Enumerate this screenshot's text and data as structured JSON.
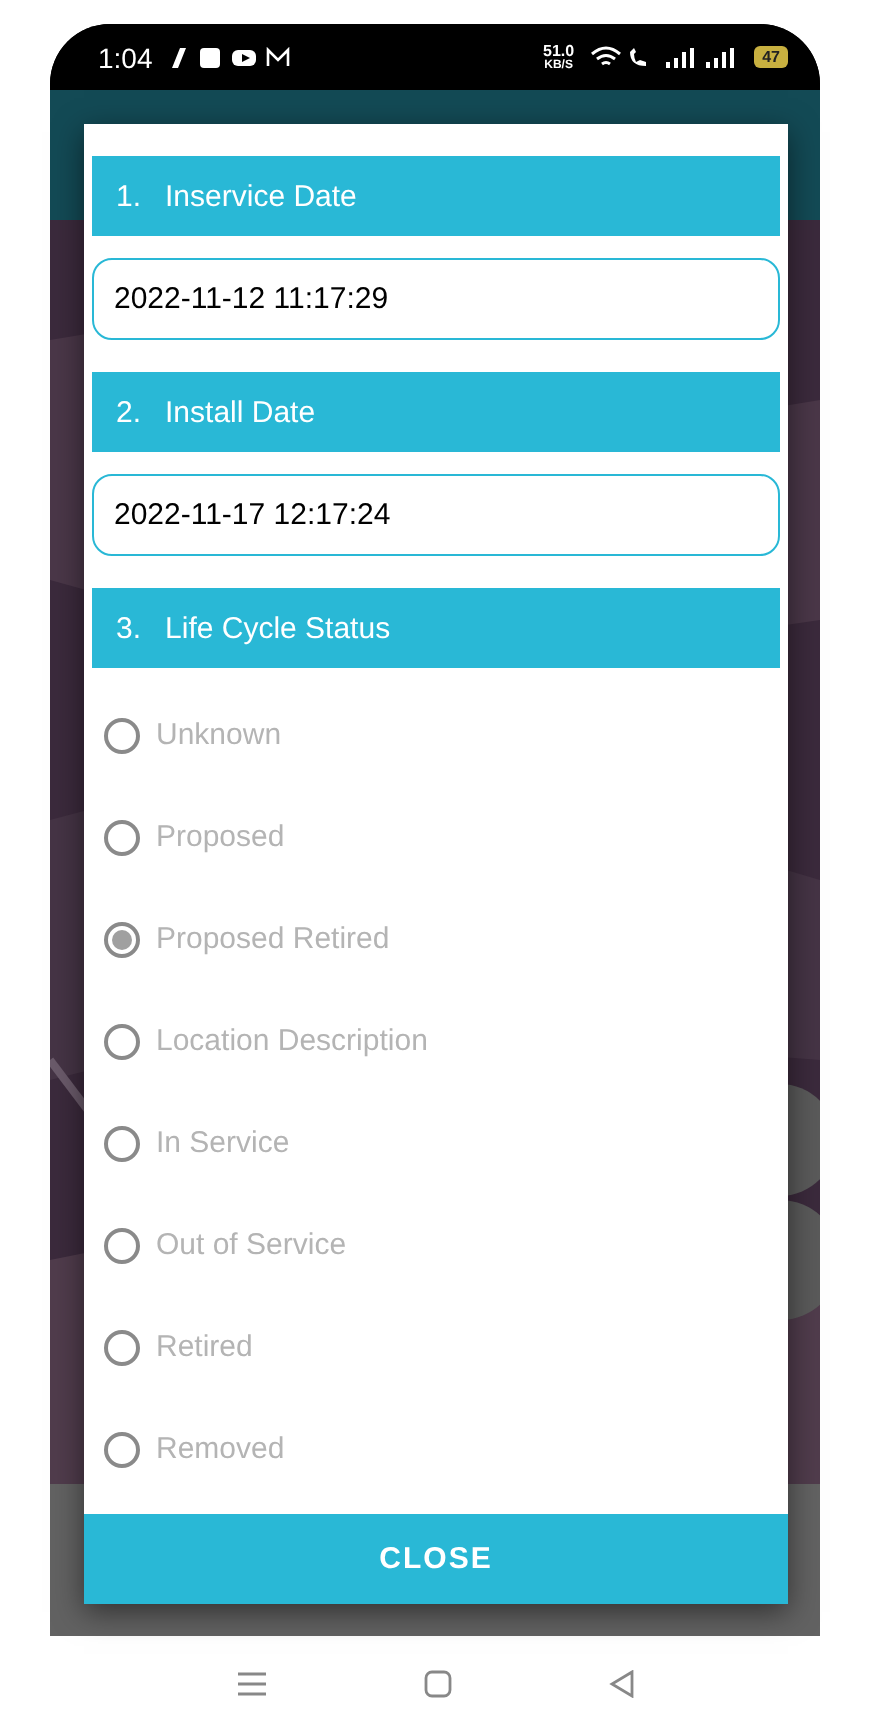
{
  "status_bar": {
    "time": "1:04",
    "speed": "51.0",
    "speed_unit": "KB/S",
    "battery": "47"
  },
  "dialog": {
    "sections": [
      {
        "number": "1.",
        "title": "Inservice Date",
        "kind": "field",
        "value": "2022-11-12 11:17:29"
      },
      {
        "number": "2.",
        "title": "Install Date",
        "kind": "field",
        "value": "2022-11-17 12:17:24"
      },
      {
        "number": "3.",
        "title": "Life Cycle Status",
        "kind": "radio",
        "options": [
          {
            "label": "Unknown",
            "selected": false
          },
          {
            "label": "Proposed",
            "selected": false
          },
          {
            "label": "Proposed Retired",
            "selected": true
          },
          {
            "label": "Location Description",
            "selected": false
          },
          {
            "label": "In Service",
            "selected": false
          },
          {
            "label": "Out of Service",
            "selected": false
          },
          {
            "label": "Retired",
            "selected": false
          },
          {
            "label": "Removed",
            "selected": false
          }
        ]
      }
    ],
    "close_button": "CLOSE"
  }
}
